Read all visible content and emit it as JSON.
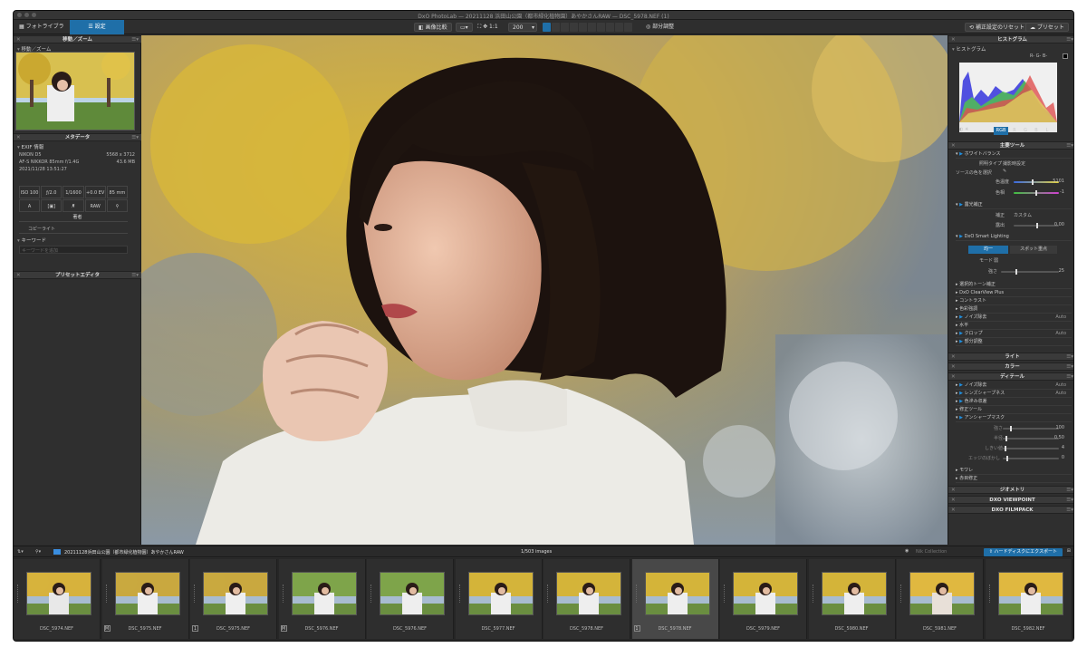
{
  "window": {
    "title": "DxO PhotoLab — 20211128 浜田山公園（都市緑化植物園）あやかさんRAW — DSC_5978.NEF (1)"
  },
  "toolbar": {
    "tab_library": "フォトライブラリ",
    "tab_customize": "設定",
    "compare": "画像比較",
    "fit": "1:1",
    "zoom": "200",
    "local_adjust": "部分調整",
    "reset": "補正設定のリセット",
    "preset": "プリセット"
  },
  "left": {
    "nav_header": "移動／ズーム",
    "nav_sub": "移動／ズーム",
    "meta_header": "メタデータ",
    "exif_label": "EXIF 情報",
    "camera": "NIKON D5",
    "resolution": "5568 x 3712",
    "lens": "AF-S NIKKOR 85mm f/1.4G",
    "filesize": "43.6 MB",
    "datetime": "2021/11/28 13:51:27",
    "exif": [
      "ISO 100",
      "ƒ/2.0",
      "1/1600 s",
      "+0.0 EV",
      "85 mm",
      "A",
      "",
      "",
      "RAW",
      ""
    ],
    "author": "著者",
    "copyright": "コピーライト",
    "keywords": "キーワード",
    "keyword_placeholder": "キーワードを追加",
    "preset_editor": "プリセットエディタ"
  },
  "right": {
    "hist_header": "ヒストグラム",
    "hist_sub": "ヒストグラム",
    "rgb_readout": "R- G- B-",
    "channels": [
      "RGB",
      "R",
      "G",
      "B",
      "L"
    ],
    "main_tools": "主要ツール",
    "wb": "ホワイトバランス",
    "wb_type_label": "照明タイプ",
    "wb_type": "撮影時設定",
    "source_color": "ソースの色を選択",
    "temp_label": "色温度",
    "temp": "5101",
    "tint_label": "色相",
    "tint": "-1",
    "exposure": "露光補正",
    "exposure_mode_label": "補正",
    "exposure_mode": "カスタム",
    "exposure_amount_label": "露出",
    "exposure_amount": "0.00",
    "smart_lighting": "DxO Smart Lighting",
    "uniform": "均一",
    "spot": "スポット重点",
    "mode_label": "モード",
    "mode": "弱",
    "strength_label": "強さ",
    "strength": "25",
    "tools1": [
      "選択的トーン補正",
      "DxO ClearView Plus",
      "コントラスト",
      "色彩強調",
      "ノイズ除去",
      "水平",
      "クロップ",
      "部分調整"
    ],
    "auto_label": "Auto",
    "light": "ライト",
    "color": "カラー",
    "detail": "ディテール",
    "detail_tools": [
      "ノイズ除去",
      "レンズシャープネス",
      "色滲み収差",
      "修正ツール",
      "アンシャープマスク"
    ],
    "usm_labels": [
      "強さ",
      "半径",
      "しきい値",
      "エッジのぼかし"
    ],
    "usm_values": [
      "100",
      "0.50",
      "4",
      "0"
    ],
    "tools2": [
      "モワレ",
      "赤目修正"
    ],
    "geometry": "ジオメトリ",
    "viewpoint": "DXO VIEWPOINT",
    "filmpack": "DXO FILMPACK"
  },
  "strip": {
    "folder": "20211128浜田山公園（都市緑化植物園）あやかさんRAW",
    "count": "1/503 images",
    "nik": "Nik Collection",
    "export": "ハードディスクにエクスポート",
    "items": [
      {
        "name": "DSC_5974.NEF",
        "badge": ""
      },
      {
        "name": "DSC_5975.NEF",
        "badge": "M"
      },
      {
        "name": "DSC_5975.NEF",
        "badge": "1"
      },
      {
        "name": "DSC_5976.NEF",
        "badge": "M"
      },
      {
        "name": "DSC_5976.NEF",
        "badge": ""
      },
      {
        "name": "DSC_5977.NEF",
        "badge": ""
      },
      {
        "name": "DSC_5978.NEF",
        "badge": ""
      },
      {
        "name": "DSC_5978.NEF",
        "badge": "1"
      },
      {
        "name": "DSC_5979.NEF",
        "badge": ""
      },
      {
        "name": "DSC_5980.NEF",
        "badge": ""
      },
      {
        "name": "DSC_5981.NEF",
        "badge": ""
      },
      {
        "name": "DSC_5982.NEF",
        "badge": ""
      }
    ]
  },
  "colors": {
    "accent": "#1f6fa8"
  }
}
